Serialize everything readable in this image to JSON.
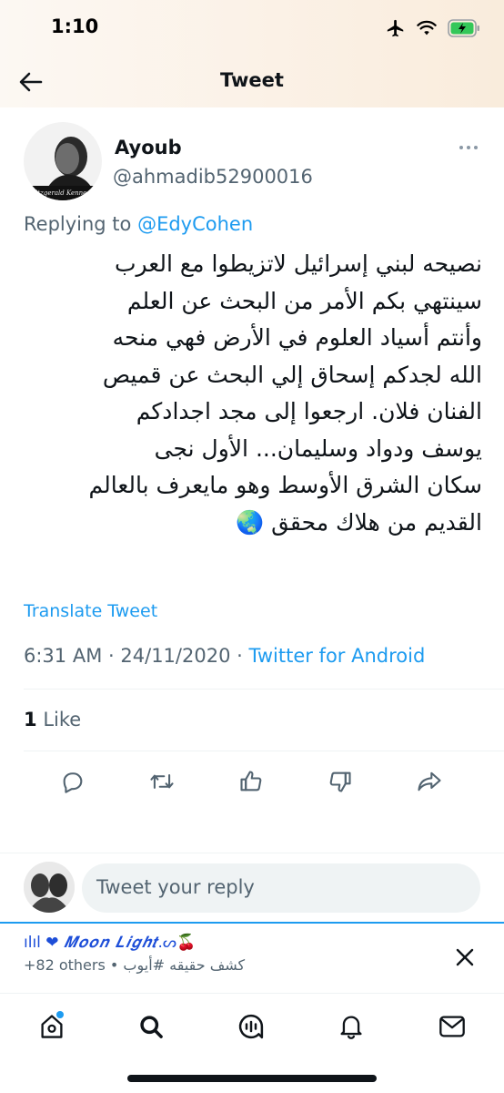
{
  "status_bar": {
    "time": "1:10",
    "icons": [
      "airplane-icon",
      "wifi-icon",
      "battery-charging-icon"
    ],
    "battery_color": "#34c759"
  },
  "nav": {
    "title": "Tweet",
    "back_icon": "back-arrow-icon"
  },
  "tweet": {
    "author": {
      "name": "Ayoub",
      "handle": "@ahmadib52900016",
      "avatar_caption": "Fitzgerald Kennedy"
    },
    "replying_prefix": "Replying to ",
    "replying_to": "@EdyCohen",
    "text_lines": [
      "نصيحه لبني إسرائيل لاتزيطوا مع العرب",
      "سينتهي بكم الأمر من البحث عن العلم",
      "وأنتم أسياد العلوم في الأرض فهي منحه",
      "الله لجدكم إسحاق إلي البحث عن قميص",
      "الفنان فلان. ارجعوا إلى مجد اجدادكم",
      "يوسف ودواد وسليمان... الأول نجى",
      "سكان الشرق الأوسط وهو مايعرف بالعالم",
      "القديم من هلاك محقق 🌏"
    ],
    "translate_label": "Translate Tweet",
    "time": "6:31 AM",
    "separator": "·",
    "date": "24/11/2020",
    "source": "Twitter for Android",
    "likes_count": "1",
    "likes_label": "Like",
    "actions": [
      "reply-icon",
      "retweet-icon",
      "upvote-icon",
      "downvote-icon",
      "share-icon"
    ]
  },
  "composer": {
    "placeholder": "Tweet your reply"
  },
  "mini_player": {
    "title_icons": "ılıl ❤",
    "title_text": "𝑴𝒐𝒐𝒏 𝑳𝒊𝒈𝒉𝒕",
    "title_suffix": ".ᔕ🍒",
    "subtitle": "+82 others • كشف حقيقه #أيوب",
    "close_icon": "close-icon"
  },
  "tab_bar": {
    "tabs": [
      "home-icon",
      "search-icon",
      "spaces-icon",
      "notifications-icon",
      "messages-icon"
    ],
    "accent": "#1d9bf0"
  },
  "colors": {
    "text_primary": "#0f1419",
    "text_secondary": "#536471",
    "link": "#1d9bf0"
  }
}
